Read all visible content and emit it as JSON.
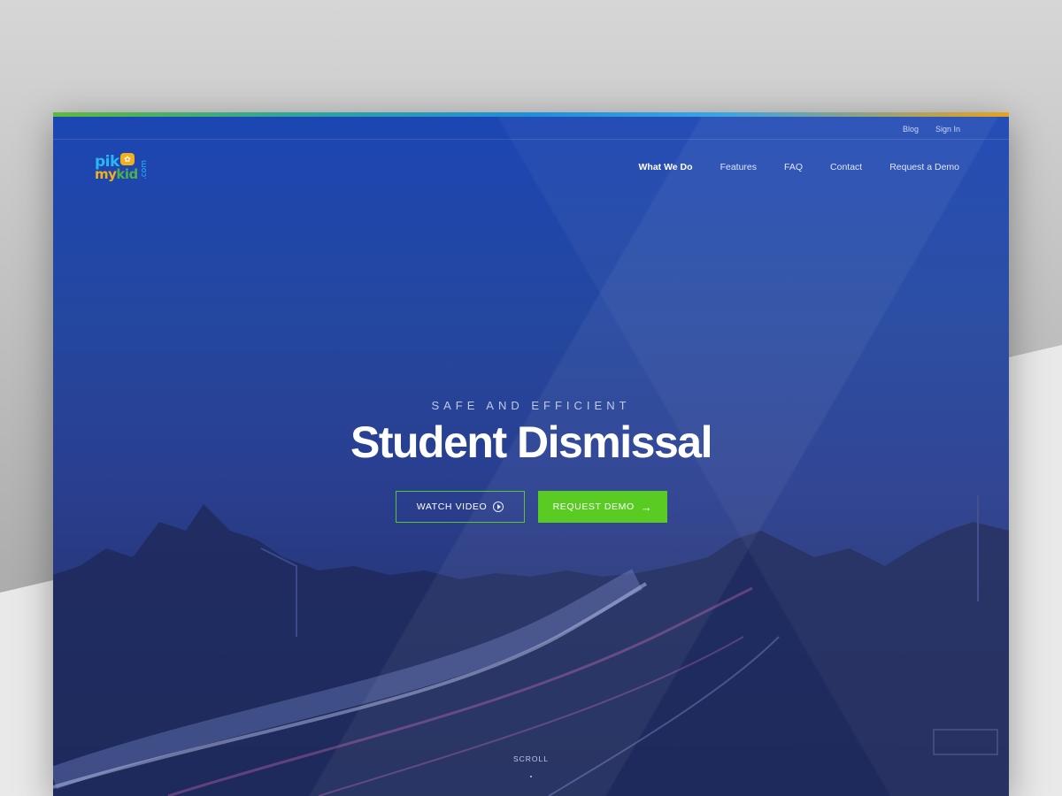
{
  "utility_nav": {
    "blog": "Blog",
    "sign_in": "Sign In"
  },
  "logo": {
    "line1": "pik",
    "line2_a": "my",
    "line2_b": "kid",
    "suffix": ".com",
    "icon": "kids-badge-icon"
  },
  "main_nav": {
    "items": [
      {
        "label": "What We Do",
        "active": true
      },
      {
        "label": "Features",
        "active": false
      },
      {
        "label": "FAQ",
        "active": false
      },
      {
        "label": "Contact",
        "active": false
      },
      {
        "label": "Request a Demo",
        "active": false
      }
    ]
  },
  "hero": {
    "kicker": "SAFE AND EFFICIENT",
    "headline": "Student Dismissal",
    "watch_video": "WATCH VIDEO",
    "request_demo": "REQUEST DEMO",
    "scroll": "SCROLL"
  },
  "colors": {
    "hero_blue": "#24479f",
    "cta_green": "#5acb23",
    "outline_green": "#57c635",
    "accent_gradient": [
      "#5dbb3a",
      "#1e8fdc",
      "#e8a21c"
    ]
  }
}
